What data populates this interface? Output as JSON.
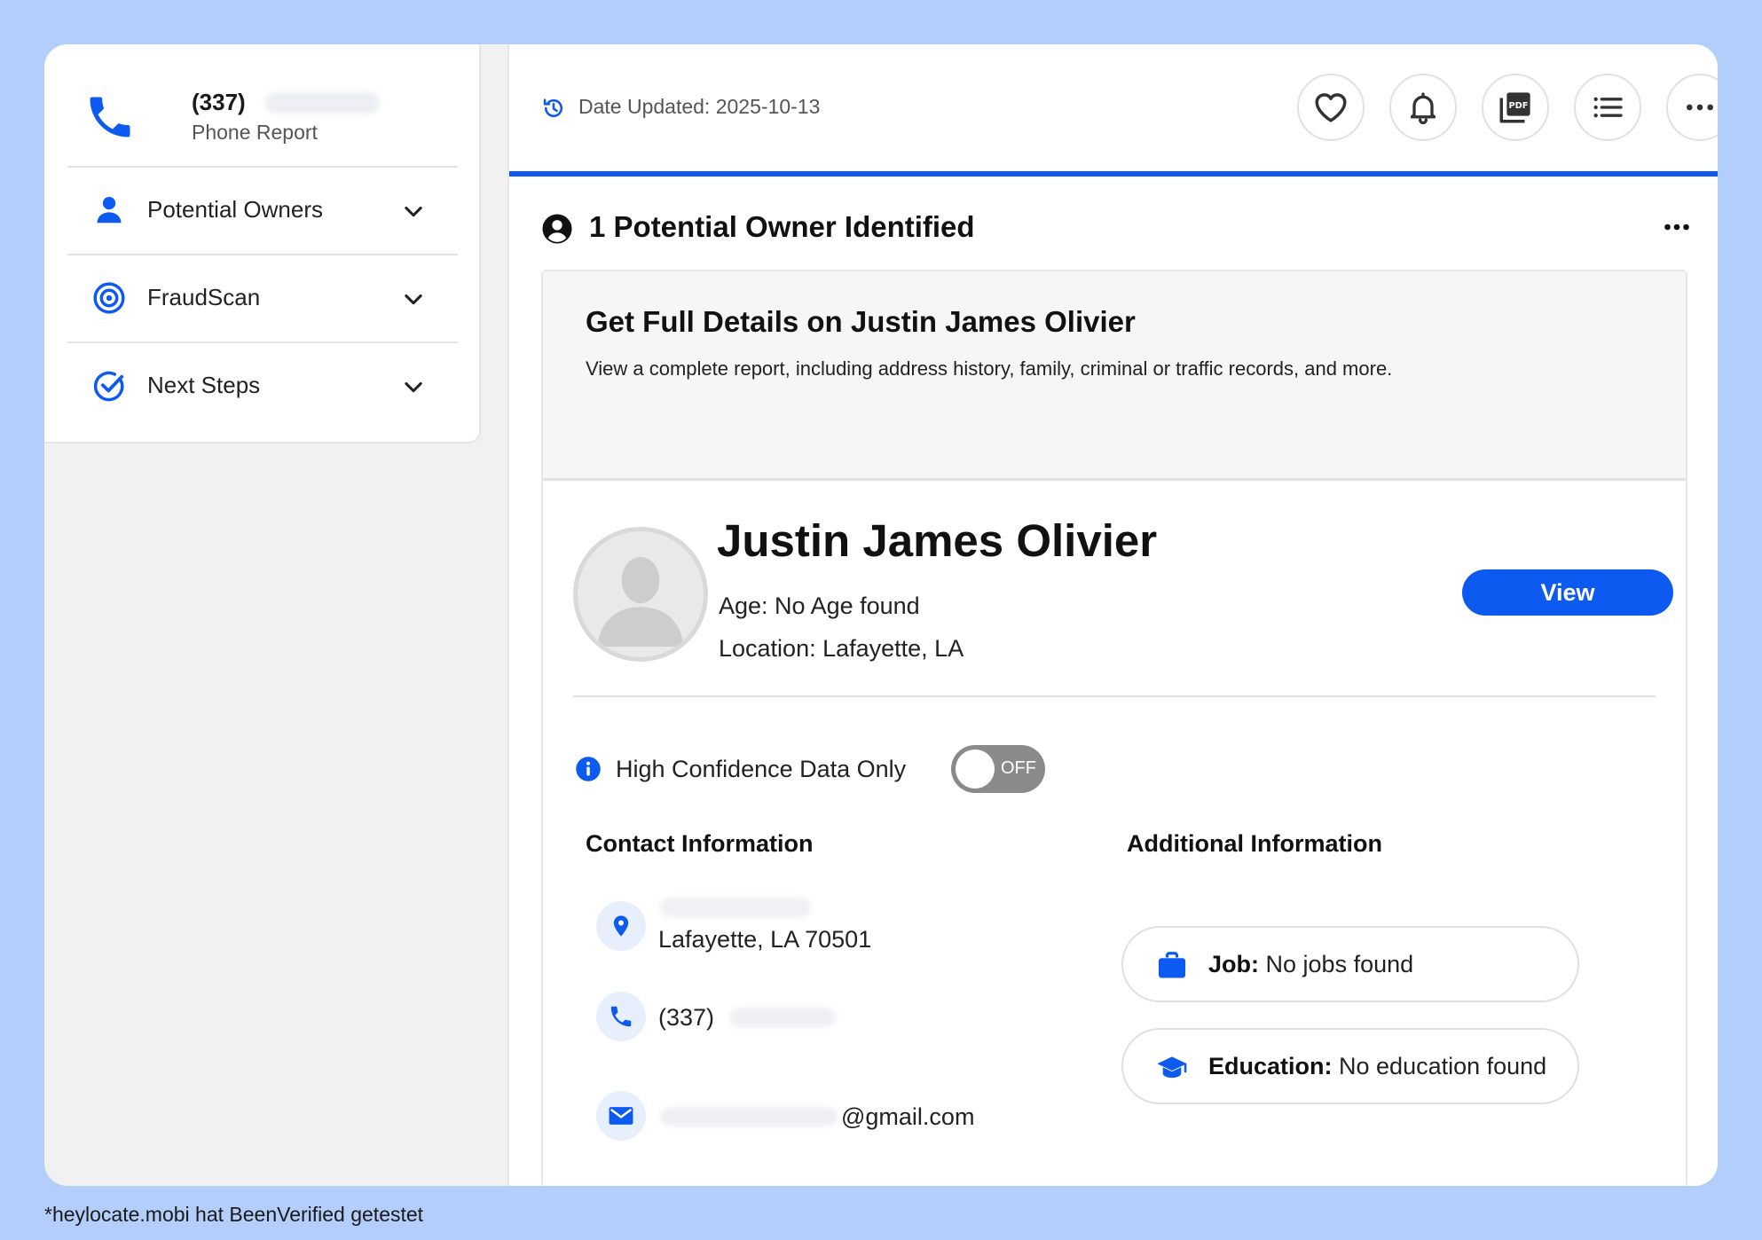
{
  "sidebar": {
    "phone_number": "(337)",
    "report_label": "Phone Report",
    "items": [
      {
        "label": "Potential Owners",
        "icon": "person-icon"
      },
      {
        "label": "FraudScan",
        "icon": "target-icon"
      },
      {
        "label": "Next Steps",
        "icon": "check-circle-icon"
      }
    ]
  },
  "topbar": {
    "date_updated": "Date Updated: 2025-10-13",
    "actions": [
      "heart-icon",
      "bell-icon",
      "pdf-icon",
      "list-icon",
      "more-icon"
    ]
  },
  "main": {
    "section_title": "1 Potential Owner Identified",
    "promo": {
      "title": "Get Full Details on Justin James Olivier",
      "description": "View a complete report, including address history, family, criminal or traffic records, and more."
    },
    "person": {
      "name": "Justin James Olivier",
      "age": "Age: No Age found",
      "location": "Location: Lafayette, LA",
      "view_label": "View"
    },
    "high_confidence": {
      "label": "High Confidence Data Only",
      "toggle_state": "OFF"
    },
    "contact": {
      "heading": "Contact Information",
      "address_line2": "Lafayette, LA 70501",
      "phone": "(337)",
      "email_suffix": "@gmail.com"
    },
    "additional": {
      "heading": "Additional Information",
      "job_label": "Job:",
      "job_value": "No jobs found",
      "education_label": "Education:",
      "education_value": "No education found"
    }
  },
  "footnote": "*heylocate.mobi hat BeenVerified getestet",
  "colors": {
    "accent": "#0d5af0",
    "background": "#b3cefb",
    "toggle_off": "#8a8a8a"
  }
}
